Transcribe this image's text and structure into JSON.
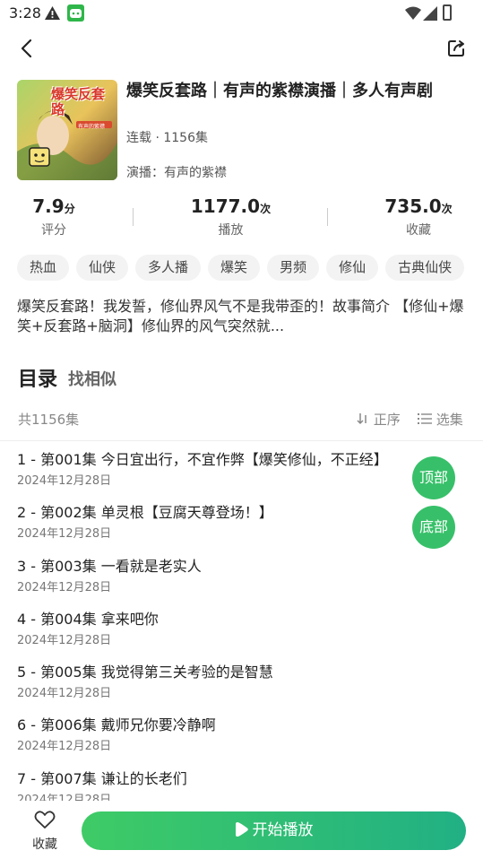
{
  "status_bar": {
    "time": "3:28"
  },
  "book": {
    "title": "爆笑反套路｜有声的紫襟演播｜多人有声剧",
    "serial_info": "连载 · 1156集",
    "narrator": "演播：有声的紫襟",
    "cover_text": "爆笑反套路",
    "cover_subtitle": "有声的紫襟"
  },
  "stats": [
    {
      "value": "7.9",
      "unit": "分",
      "label": "评分"
    },
    {
      "value": "1177.0",
      "unit": "次",
      "label": "播放"
    },
    {
      "value": "735.0",
      "unit": "次",
      "label": "收藏"
    }
  ],
  "tags": [
    "热血",
    "仙侠",
    "多人播",
    "爆笑",
    "男频",
    "修仙",
    "古典仙侠"
  ],
  "description": "爆笑反套路！我发誓，修仙界风气不是我带歪的！故事简介 【修仙+爆笑+反套路+脑洞】修仙界的风气突然就...",
  "toc": {
    "title": "目录",
    "similar": "找相似",
    "count": "共1156集",
    "sort_label": "正序",
    "select_label": "选集"
  },
  "episodes": [
    {
      "title": "1 - 第001集 今日宜出行，不宜作弊【爆笑修仙，不正经】",
      "date": "2024年12月28日"
    },
    {
      "title": "2 - 第002集 单灵根【豆腐天尊登场！】",
      "date": "2024年12月28日"
    },
    {
      "title": "3 - 第003集 一看就是老实人",
      "date": "2024年12月28日"
    },
    {
      "title": "4 - 第004集 拿来吧你",
      "date": "2024年12月28日"
    },
    {
      "title": "5 - 第005集 我觉得第三关考验的是智慧",
      "date": "2024年12月28日"
    },
    {
      "title": "6 - 第006集 戴师兄你要冷静啊",
      "date": "2024年12月28日"
    },
    {
      "title": "7 - 第007集 谦让的长老们",
      "date": "2024年12月28日"
    }
  ],
  "float_buttons": {
    "top": "顶部",
    "bottom": "底部"
  },
  "bottom_bar": {
    "favorite_label": "收藏",
    "play_label": "开始播放"
  },
  "colors": {
    "accent": "#37c069",
    "accent_dark": "#21b084"
  }
}
